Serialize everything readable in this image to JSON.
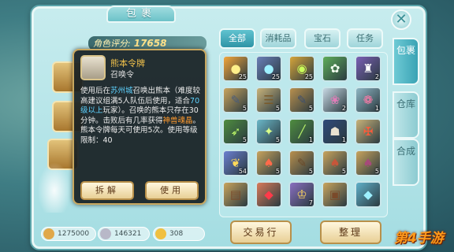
{
  "panel": {
    "title": "包裹",
    "close_label": "✕",
    "score_label": "角色评分:",
    "score_value": "17658"
  },
  "tabs": [
    {
      "label": "全部",
      "active": true
    },
    {
      "label": "消耗品",
      "active": false
    },
    {
      "label": "宝石",
      "active": false
    },
    {
      "label": "任务",
      "active": false
    }
  ],
  "side_tabs": [
    {
      "label": "包裹",
      "active": true
    },
    {
      "label": "仓库",
      "active": false
    },
    {
      "label": "合成",
      "active": false
    }
  ],
  "tooltip": {
    "title": "熊本令牌",
    "subtitle": "召唤令",
    "body_1": "使用后在",
    "city": "苏州城",
    "body_2": "召唤出熊本（难度较高建议组满5人队伍后使用，适合",
    "level": "70级以上",
    "body_3": "玩家）。召唤的熊本只存在30分钟。击败后有几率获得",
    "reward": "神兽魂晶",
    "body_4": "。熊本令牌每天可使用5次。使用等级限制：40",
    "btn_split": "拆解",
    "btn_use": "使用"
  },
  "grid_items": [
    {
      "icon": "crystal-ball-icon",
      "glyph": "●",
      "bg": "#f3a63a",
      "fg": "#ffef8a",
      "count": "25"
    },
    {
      "icon": "crystal-ball-icon",
      "glyph": "●",
      "bg": "#6a7fb8",
      "fg": "#9ef0ff",
      "count": "25"
    },
    {
      "icon": "orb-icon",
      "glyph": "◉",
      "bg": "#d6a53a",
      "fg": "#c9ff5a",
      "count": "25"
    },
    {
      "icon": "paw-icon",
      "glyph": "✿",
      "bg": "#5fae5a",
      "fg": "#f2fff0",
      "count": ""
    },
    {
      "icon": "potion-icon",
      "glyph": "♜",
      "bg": "#7a5fb5",
      "fg": "#ffffff",
      "count": "2"
    },
    {
      "icon": "scroll-icon",
      "glyph": "✎",
      "bg": "#c9a45e",
      "fg": "#4a5c7a",
      "count": "5"
    },
    {
      "icon": "paper-icon",
      "glyph": "☰",
      "bg": "#c9b37a",
      "fg": "#7a5a2a",
      "count": "5"
    },
    {
      "icon": "scroll-icon",
      "glyph": "✎",
      "bg": "#b9904e",
      "fg": "#3d4f6d",
      "count": "5"
    },
    {
      "icon": "flower-icon",
      "glyph": "❀",
      "bg": "#c7d8e3",
      "fg": "#e07cb8",
      "count": "2"
    },
    {
      "icon": "lotus-icon",
      "glyph": "❁",
      "bg": "#8fb6c4",
      "fg": "#ff7aa8",
      "count": "1"
    },
    {
      "icon": "arrow-icon",
      "glyph": "➶",
      "bg": "#4f8d3f",
      "fg": "#c3ff6b",
      "count": "5"
    },
    {
      "icon": "gem-cluster-icon",
      "glyph": "✦",
      "bg": "#6bb8c9",
      "fg": "#d9ff8a",
      "count": "5"
    },
    {
      "icon": "bamboo-icon",
      "glyph": "╱",
      "bg": "#4f8d3f",
      "fg": "#b8f06a",
      "count": "1"
    },
    {
      "icon": "token-icon",
      "glyph": "☗",
      "bg": "#2f4a7a",
      "fg": "#e8e1d0",
      "count": "1"
    },
    {
      "icon": "sword-icon",
      "glyph": "✠",
      "bg": "#c9b37a",
      "fg": "#ff5a3a",
      "count": ""
    },
    {
      "icon": "butterfly-icon",
      "glyph": "❦",
      "bg": "#6b7fd0",
      "fg": "#ffd95a",
      "count": "54"
    },
    {
      "icon": "charm-icon",
      "glyph": "♠",
      "bg": "#c9a45e",
      "fg": "#ff6a4a",
      "count": "5"
    },
    {
      "icon": "scroll-icon",
      "glyph": "✎",
      "bg": "#b9904e",
      "fg": "#6a4a2a",
      "count": "5"
    },
    {
      "icon": "charm-icon",
      "glyph": "♠",
      "bg": "#c9a45e",
      "fg": "#c7563a",
      "count": "5"
    },
    {
      "icon": "charm-icon",
      "glyph": "♠",
      "bg": "#c9a45e",
      "fg": "#a64a7a",
      "count": "5"
    },
    {
      "icon": "book-icon",
      "glyph": "▤",
      "bg": "#c9a45e",
      "fg": "#7a4a2a",
      "count": ""
    },
    {
      "icon": "gem-red-icon",
      "glyph": "◆",
      "bg": "#d87a5a",
      "fg": "#ff3a4a",
      "count": ""
    },
    {
      "icon": "crown-icon",
      "glyph": "♔",
      "bg": "#8a6fc0",
      "fg": "#ffd95a",
      "count": "7"
    },
    {
      "icon": "chest-icon",
      "glyph": "▣",
      "bg": "#c9a45e",
      "fg": "#7a4a2a",
      "count": ""
    },
    {
      "icon": "gem-blue-icon",
      "glyph": "◆",
      "bg": "#5fb0c9",
      "fg": "#9ef0ff",
      "count": ""
    }
  ],
  "currencies": [
    {
      "icon": "gold-coin-icon",
      "color": "#e0a84a",
      "value": "1275000"
    },
    {
      "icon": "silver-coin-icon",
      "color": "#b8b8c8",
      "value": "146321"
    },
    {
      "icon": "gem-coin-icon",
      "color": "#f0c040",
      "value": "308"
    }
  ],
  "bottom_buttons": {
    "trade": "交易行",
    "sort": "整理"
  },
  "watermark": "第4手游"
}
